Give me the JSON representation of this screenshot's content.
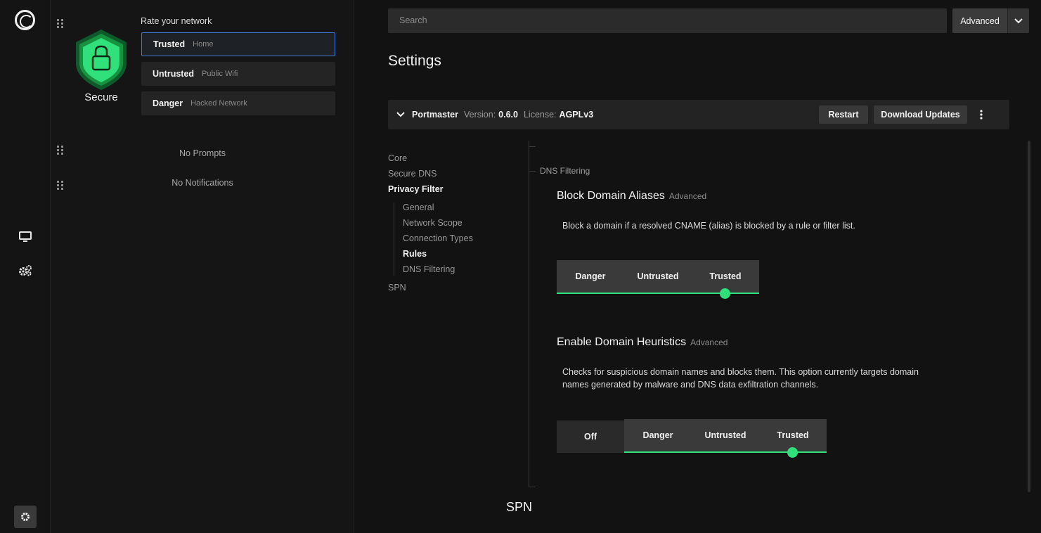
{
  "rail": {
    "icons": [
      "portmaster-logo-icon",
      "monitor-icon",
      "gears-icon",
      "settings-gear-icon"
    ]
  },
  "status": {
    "label": "Secure",
    "color": "#30e07a"
  },
  "rate": {
    "title": "Rate your network",
    "options": [
      {
        "main": "Trusted",
        "sub": "Home"
      },
      {
        "main": "Untrusted",
        "sub": "Public Wifi"
      },
      {
        "main": "Danger",
        "sub": "Hacked Network"
      }
    ]
  },
  "prompts": {
    "empty": "No Prompts"
  },
  "notifications": {
    "empty": "No Notifications"
  },
  "search": {
    "placeholder": "Search"
  },
  "mode": {
    "label": "Advanced"
  },
  "page": {
    "title": "Settings"
  },
  "portmaster": {
    "name": "Portmaster",
    "version_key": "Version:",
    "version": "0.6.0",
    "license_key": "License:",
    "license": "AGPLv3",
    "restart": "Restart",
    "download": "Download Updates"
  },
  "toc": {
    "items": [
      "Core",
      "Secure DNS",
      "Privacy Filter",
      "SPN"
    ],
    "sub": [
      "General",
      "Network Scope",
      "Connection Types",
      "Rules",
      "DNS Filtering"
    ]
  },
  "section": {
    "label": "DNS Filtering"
  },
  "settings": [
    {
      "title": "Block Domain Aliases",
      "tag": "Advanced",
      "desc": "Block a domain if a resolved CNAME (alias) is blocked by a rule or filter list.",
      "segments": [
        "Danger",
        "Untrusted",
        "Trusted"
      ],
      "value": "Trusted"
    },
    {
      "title": "Enable Domain Heuristics",
      "tag": "Advanced",
      "desc": "Checks for suspicious domain names and blocks them. This option currently targets domain names generated by malware and DNS data exfiltration channels.",
      "off": "Off",
      "segments": [
        "Danger",
        "Untrusted",
        "Trusted"
      ],
      "value": "Trusted"
    }
  ],
  "next_section": {
    "title": "SPN"
  },
  "accent": "#30e07a"
}
